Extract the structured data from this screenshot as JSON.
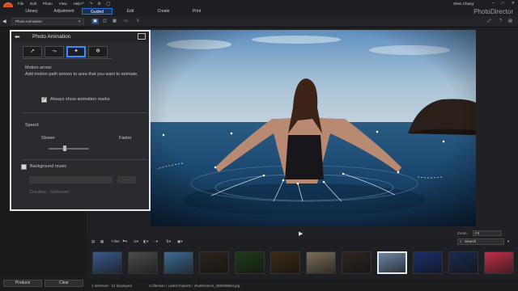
{
  "window": {
    "menus": [
      "File",
      "Edit",
      "Photo",
      "View",
      "Help"
    ],
    "user": "Shen Chang",
    "app_name": "PhotoDirector"
  },
  "modes": [
    {
      "label": "Library"
    },
    {
      "label": "Adjustment"
    },
    {
      "label": "Guided",
      "active": true
    },
    {
      "label": "Edit"
    },
    {
      "label": "Create"
    },
    {
      "label": "Print"
    }
  ],
  "toolbar": {
    "breadcrumb": "Photo Animation"
  },
  "panel": {
    "title": "Photo Animation",
    "tabs": [
      {
        "icon": "motion-arrow-icon"
      },
      {
        "icon": "motion-path-icon"
      },
      {
        "icon": "sparkle-icon",
        "active": true
      },
      {
        "icon": "snowflake-icon"
      }
    ],
    "section_heading": "Motion arrow:",
    "instruction": "Add motion path arrows to area that you want to animate.",
    "always_show_label": "Always show animation marks",
    "speed_label": "Speed:",
    "slower": "Slower",
    "faster": "Faster",
    "bg_music_label": "Background music",
    "duration": "Duration : Unknown",
    "browse": "..."
  },
  "playback": {
    "zoom_label": "Zoom:",
    "zoom_value": "Fit"
  },
  "filmstrip": {
    "filter_label": "Filter",
    "search_placeholder": "Search",
    "thumb_colors": [
      "#3a5a8a",
      "#4a4e4c",
      "#3d6c94",
      "#2b241e",
      "#1f3a1a",
      "#3a2b15",
      "#7b6f5a",
      "#2c2622",
      "#6e86a3",
      "#1a2f6b",
      "#1a2a4d",
      "#c2304a"
    ]
  },
  "buttons": {
    "produce": "Produce",
    "clear": "Clear"
  },
  "status": {
    "selection": "1 selected - 12 displayed",
    "path": "Collection / Latest Imports / shutterstock_408406664.jpg"
  }
}
